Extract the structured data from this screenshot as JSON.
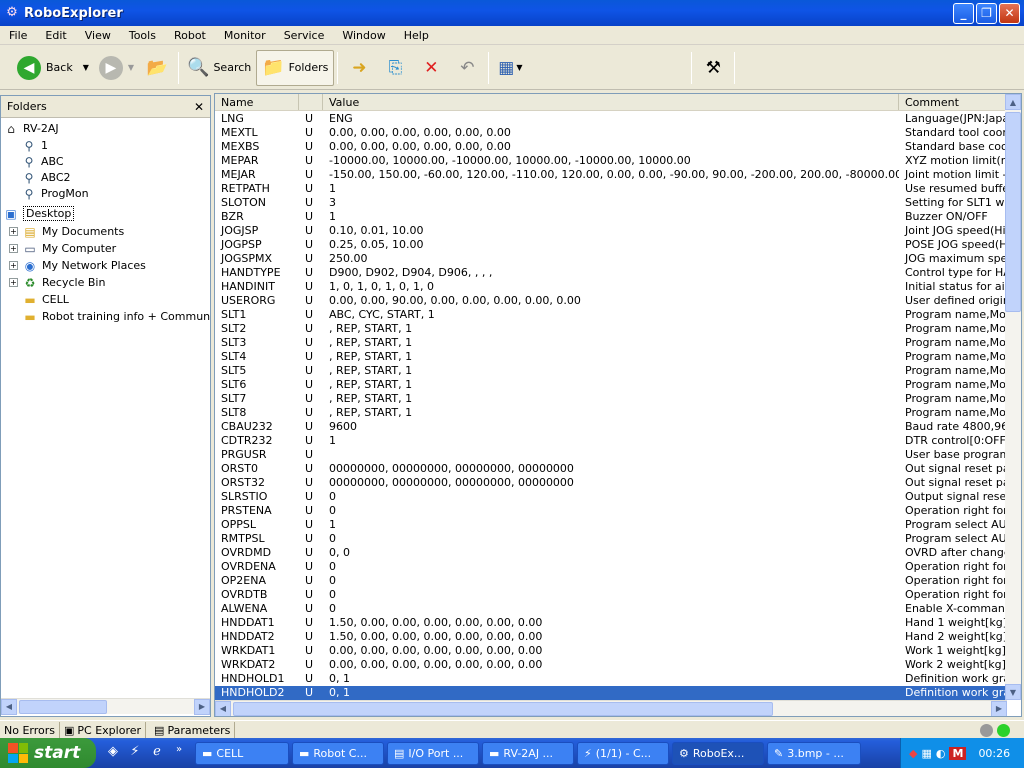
{
  "window": {
    "title": "RoboExplorer"
  },
  "menu": [
    "File",
    "Edit",
    "View",
    "Tools",
    "Robot",
    "Monitor",
    "Service",
    "Window",
    "Help"
  ],
  "toolbar": {
    "back": "Back",
    "search": "Search",
    "folders": "Folders"
  },
  "folders_panel": {
    "title": "Folders",
    "tree": [
      {
        "label": "RV-2AJ"
      },
      {
        "label": "1"
      },
      {
        "label": "ABC"
      },
      {
        "label": "ABC2"
      },
      {
        "label": "ProgMon"
      },
      {
        "label": "Desktop"
      },
      {
        "label": "My Documents"
      },
      {
        "label": "My Computer"
      },
      {
        "label": "My Network Places"
      },
      {
        "label": "Recycle Bin"
      },
      {
        "label": "CELL"
      },
      {
        "label": "Robot training info + Communicatio"
      }
    ]
  },
  "table": {
    "columns": [
      "Name",
      "",
      "Value",
      "Comment"
    ],
    "rows": [
      [
        "LNG",
        "U",
        "ENG",
        "Language(JPN:Japan"
      ],
      [
        "MEXTL",
        "U",
        "0.00, 0.00, 0.00, 0.00, 0.00, 0.00",
        "Standard tool coordin"
      ],
      [
        "MEXBS",
        "U",
        "0.00, 0.00, 0.00, 0.00, 0.00, 0.00",
        "Standard base coordi"
      ],
      [
        "MEPAR",
        "U",
        "-10000.00, 10000.00, -10000.00, 10000.00, -10000.00, 10000.00",
        "XYZ motion limit(mm)"
      ],
      [
        "MEJAR",
        "U",
        "-150.00, 150.00, -60.00, 120.00, -110.00, 120.00, 0.00, 0.00, -90.00, 90.00, -200.00, 200.00, -80000.00, 80000.00, -...",
        "Joint motion limit -/+(d"
      ],
      [
        "RETPATH",
        "U",
        "1",
        "Use resumed buffer 1"
      ],
      [
        "SLOTON",
        "U",
        "3",
        "Setting for SLT1 whe"
      ],
      [
        "BZR",
        "U",
        "1",
        "Buzzer ON/OFF"
      ],
      [
        "JOGJSP",
        "U",
        "0.10, 0.01, 10.00",
        "Joint JOG speed(High"
      ],
      [
        "JOGPSP",
        "U",
        "0.25, 0.05, 10.00",
        "POSE JOG speed(Hig"
      ],
      [
        "JOGSPMX",
        "U",
        "250.00",
        "JOG maximum speed"
      ],
      [
        "HANDTYPE",
        "U",
        "D900, D902, D904, D906, , , ,",
        "Control type for HAND"
      ],
      [
        "HANDINIT",
        "U",
        "1, 0, 1, 0, 1, 0, 1, 0",
        "Initial status for air han"
      ],
      [
        "USERORG",
        "U",
        "0.00, 0.00, 90.00, 0.00, 0.00, 0.00, 0.00, 0.00",
        "User defined origin (Jo"
      ],
      [
        "SLT1",
        "U",
        "ABC, CYC, START, 1",
        "Program name,Mode,"
      ],
      [
        "SLT2",
        "U",
        ", REP, START, 1",
        "Program name,Mode,"
      ],
      [
        "SLT3",
        "U",
        ", REP, START, 1",
        "Program name,Mode,"
      ],
      [
        "SLT4",
        "U",
        ", REP, START, 1",
        "Program name,Mode,"
      ],
      [
        "SLT5",
        "U",
        ", REP, START, 1",
        "Program name,Mode,"
      ],
      [
        "SLT6",
        "U",
        ", REP, START, 1",
        "Program name,Mode,"
      ],
      [
        "SLT7",
        "U",
        ", REP, START, 1",
        "Program name,Mode,"
      ],
      [
        "SLT8",
        "U",
        ", REP, START, 1",
        "Program name,Mode,"
      ],
      [
        "CBAU232",
        "U",
        "9600",
        "Baud rate 4800,9600"
      ],
      [
        "CDTR232",
        "U",
        "1",
        "DTR control[0:OFF,1:"
      ],
      [
        "PRGUSR",
        "U",
        "",
        "User base program na"
      ],
      [
        "ORST0",
        "U",
        "00000000, 00000000, 00000000, 00000000",
        "Out signal reset patte"
      ],
      [
        "ORST32",
        "U",
        "00000000, 00000000, 00000000, 00000000",
        "Out signal reset patte"
      ],
      [
        "SLRSTIO",
        "U",
        "0",
        "Output signal reset wi"
      ],
      [
        "PRSTENA",
        "U",
        "0",
        "Operation right for pro"
      ],
      [
        "OPPSL",
        "U",
        "1",
        "Program select AUTC"
      ],
      [
        "RMTPSL",
        "U",
        "0",
        "Program select AUTC"
      ],
      [
        "OVRDMD",
        "U",
        "0, 0",
        "OVRD after change M"
      ],
      [
        "OVRDENA",
        "U",
        "0",
        "Operation right for OV"
      ],
      [
        "OP2ENA",
        "U",
        "0",
        "Operation right for ext"
      ],
      [
        "OVRDTB",
        "U",
        "0",
        "Operation right for OV"
      ],
      [
        "ALWENA",
        "U",
        "0",
        "Enable X-command,S"
      ],
      [
        "HNDDAT1",
        "U",
        "1.50, 0.00, 0.00, 0.00, 0.00, 0.00, 0.00",
        "Hand 1 weight[kg],fig"
      ],
      [
        "HNDDAT2",
        "U",
        "1.50, 0.00, 0.00, 0.00, 0.00, 0.00, 0.00",
        "Hand 2 weight[kg],fig"
      ],
      [
        "WRKDAT1",
        "U",
        "0.00, 0.00, 0.00, 0.00, 0.00, 0.00, 0.00",
        "Work 1 weight[kg],fig"
      ],
      [
        "WRKDAT2",
        "U",
        "0.00, 0.00, 0.00, 0.00, 0.00, 0.00, 0.00",
        "Work 2 weight[kg],fig"
      ],
      [
        "HNDHOLD1",
        "U",
        "0, 1",
        "Definition work grasp"
      ],
      [
        "HNDHOLD2",
        "U",
        "0, 1",
        "Definition work grasp"
      ]
    ]
  },
  "status": {
    "errors": "No Errors",
    "tab1": "PC Explorer",
    "tab2": "Parameters"
  },
  "taskbar": {
    "start": "start",
    "buttons": [
      "CELL",
      "Robot C...",
      "I/O Port ...",
      "RV-2AJ ...",
      "(1/1) - C...",
      "RoboEx...",
      "3.bmp - ..."
    ],
    "clock": "00:26"
  }
}
